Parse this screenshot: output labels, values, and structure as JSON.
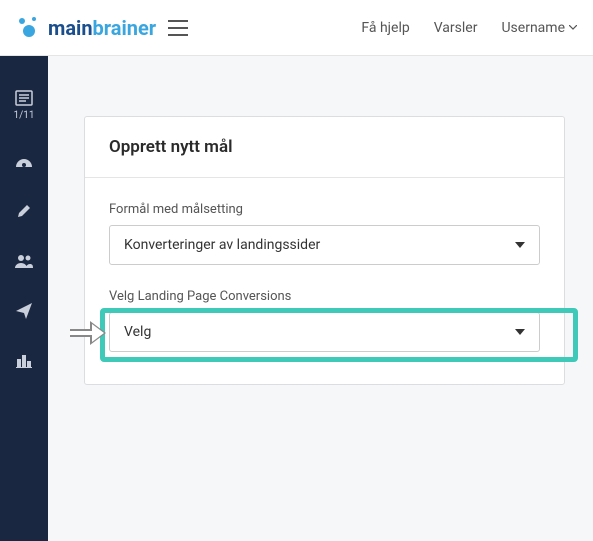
{
  "topbar": {
    "help_label": "Få hjelp",
    "alerts_label": "Varsler",
    "username_label": "Username"
  },
  "sidebar": {
    "progress_label": "1/11"
  },
  "card": {
    "title": "Opprett nytt mål",
    "field1_label": "Formål med målsetting",
    "field1_value": "Konverteringer av landingssider",
    "field2_label": "Velg Landing Page Conversions",
    "field2_value": "Velg"
  }
}
